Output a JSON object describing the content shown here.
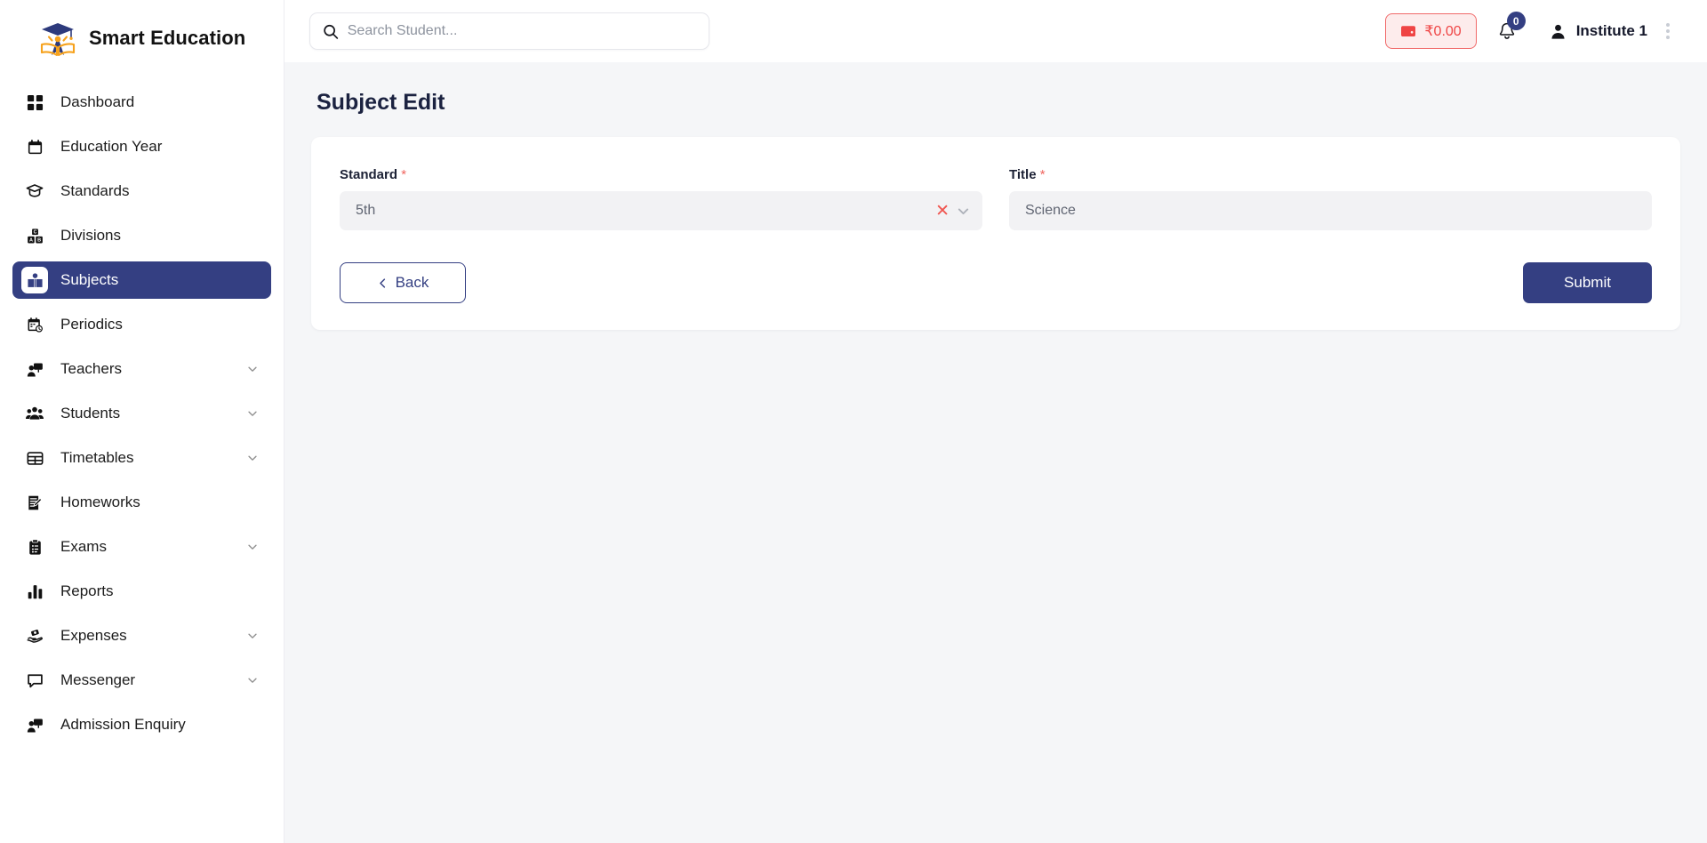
{
  "brand": {
    "name": "Smart Education",
    "logo_icon": "graduation-cap-book-logo"
  },
  "sidebar": {
    "items": [
      {
        "label": "Dashboard",
        "icon": "grid-icon",
        "expandable": false,
        "active": false
      },
      {
        "label": "Education Year",
        "icon": "calendar-icon",
        "expandable": false,
        "active": false
      },
      {
        "label": "Standards",
        "icon": "graduation-cap-icon",
        "expandable": false,
        "active": false
      },
      {
        "label": "Divisions",
        "icon": "alphabet-blocks-icon",
        "expandable": false,
        "active": false
      },
      {
        "label": "Subjects",
        "icon": "open-book-icon",
        "expandable": false,
        "active": true
      },
      {
        "label": "Periodics",
        "icon": "calendar-clock-icon",
        "expandable": false,
        "active": false
      },
      {
        "label": "Teachers",
        "icon": "presenter-icon",
        "expandable": true,
        "active": false
      },
      {
        "label": "Students",
        "icon": "users-icon",
        "expandable": true,
        "active": false
      },
      {
        "label": "Timetables",
        "icon": "table-icon",
        "expandable": true,
        "active": false
      },
      {
        "label": "Homeworks",
        "icon": "note-edit-icon",
        "expandable": false,
        "active": false
      },
      {
        "label": "Exams",
        "icon": "clipboard-icon",
        "expandable": true,
        "active": false
      },
      {
        "label": "Reports",
        "icon": "bar-chart-icon",
        "expandable": false,
        "active": false
      },
      {
        "label": "Expenses",
        "icon": "hand-money-icon",
        "expandable": true,
        "active": false
      },
      {
        "label": "Messenger",
        "icon": "chat-bubble-icon",
        "expandable": true,
        "active": false
      },
      {
        "label": "Admission Enquiry",
        "icon": "presenter-icon",
        "expandable": false,
        "active": false
      }
    ]
  },
  "topbar": {
    "search": {
      "value": "",
      "placeholder": "Search Student..."
    },
    "wallet": {
      "amount": "₹0.00",
      "icon": "wallet-icon"
    },
    "notifications": {
      "count": "0",
      "icon": "bell-icon"
    },
    "user": {
      "name": "Institute 1",
      "icon": "user-icon"
    },
    "kebab_icon": "more-vertical-icon"
  },
  "page": {
    "title": "Subject Edit",
    "form": {
      "standard": {
        "label": "Standard",
        "required_marker": "*",
        "value": "5th",
        "clear_icon": "close-icon",
        "dropdown_icon": "chevron-down-icon"
      },
      "title": {
        "label": "Title",
        "required_marker": "*",
        "value": "Science",
        "placeholder": "Title"
      }
    },
    "buttons": {
      "back": "Back",
      "submit": "Submit",
      "back_icon": "chevron-left-icon"
    }
  },
  "colors": {
    "accent": "#343f82",
    "danger": "#ef4444",
    "required": "#f0655f",
    "page_bg": "#f5f6f8"
  }
}
